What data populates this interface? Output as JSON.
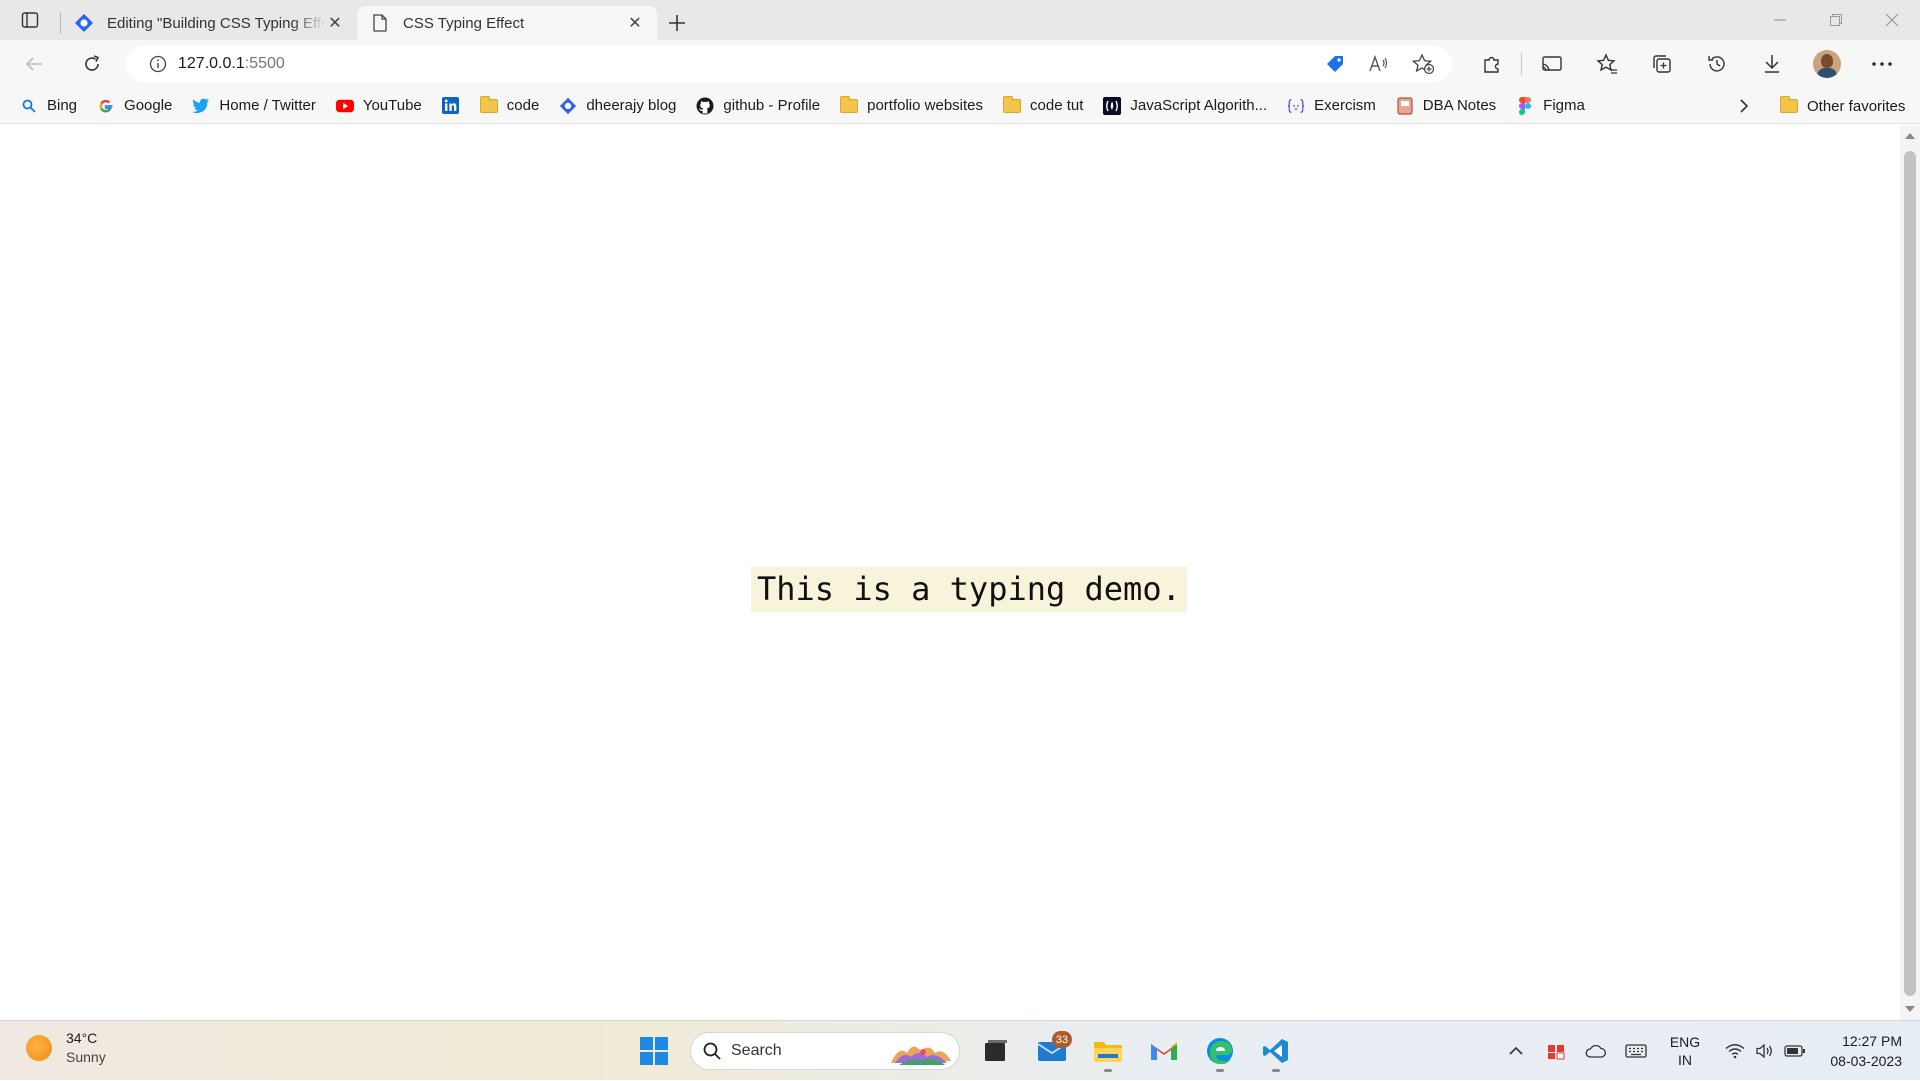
{
  "tabs": [
    {
      "title": "Editing \"Building CSS Typing Effect\"",
      "favicon": "hashnode-icon",
      "active": false
    },
    {
      "title": "CSS Typing Effect",
      "favicon": "page-icon",
      "active": true
    }
  ],
  "address_bar": {
    "host": "127.0.0.1",
    "port": ":5500"
  },
  "favorites": [
    {
      "label": "Bing",
      "icon": "search-icon"
    },
    {
      "label": "Google",
      "icon": "google-icon"
    },
    {
      "label": "Home / Twitter",
      "icon": "twitter-icon"
    },
    {
      "label": "YouTube",
      "icon": "youtube-icon"
    },
    {
      "label": "",
      "icon": "linkedin-icon"
    },
    {
      "label": "code",
      "icon": "folder-icon"
    },
    {
      "label": "dheerajy blog",
      "icon": "hashnode-icon"
    },
    {
      "label": "github - Profile",
      "icon": "github-icon"
    },
    {
      "label": "portfolio websites",
      "icon": "folder-icon"
    },
    {
      "label": "code tut",
      "icon": "folder-icon"
    },
    {
      "label": "JavaScript Algorith...",
      "icon": "fcc-icon"
    },
    {
      "label": "Exercism",
      "icon": "exercism-icon"
    },
    {
      "label": "DBA Notes",
      "icon": "notes-icon"
    },
    {
      "label": "Figma",
      "icon": "figma-icon"
    }
  ],
  "other_favorites": "Other favorites",
  "page": {
    "demo_text": "This is a typing demo."
  },
  "taskbar": {
    "weather": {
      "temp": "34°C",
      "condition": "Sunny"
    },
    "search_label": "Search",
    "mail_badge": "33",
    "language": {
      "line1": "ENG",
      "line2": "IN"
    },
    "clock": {
      "time": "12:27 PM",
      "date": "08-03-2023"
    }
  },
  "colors": {
    "accent": "#0078d4",
    "highlight": "#f8f4dc",
    "hashnode": "#2962ff"
  }
}
